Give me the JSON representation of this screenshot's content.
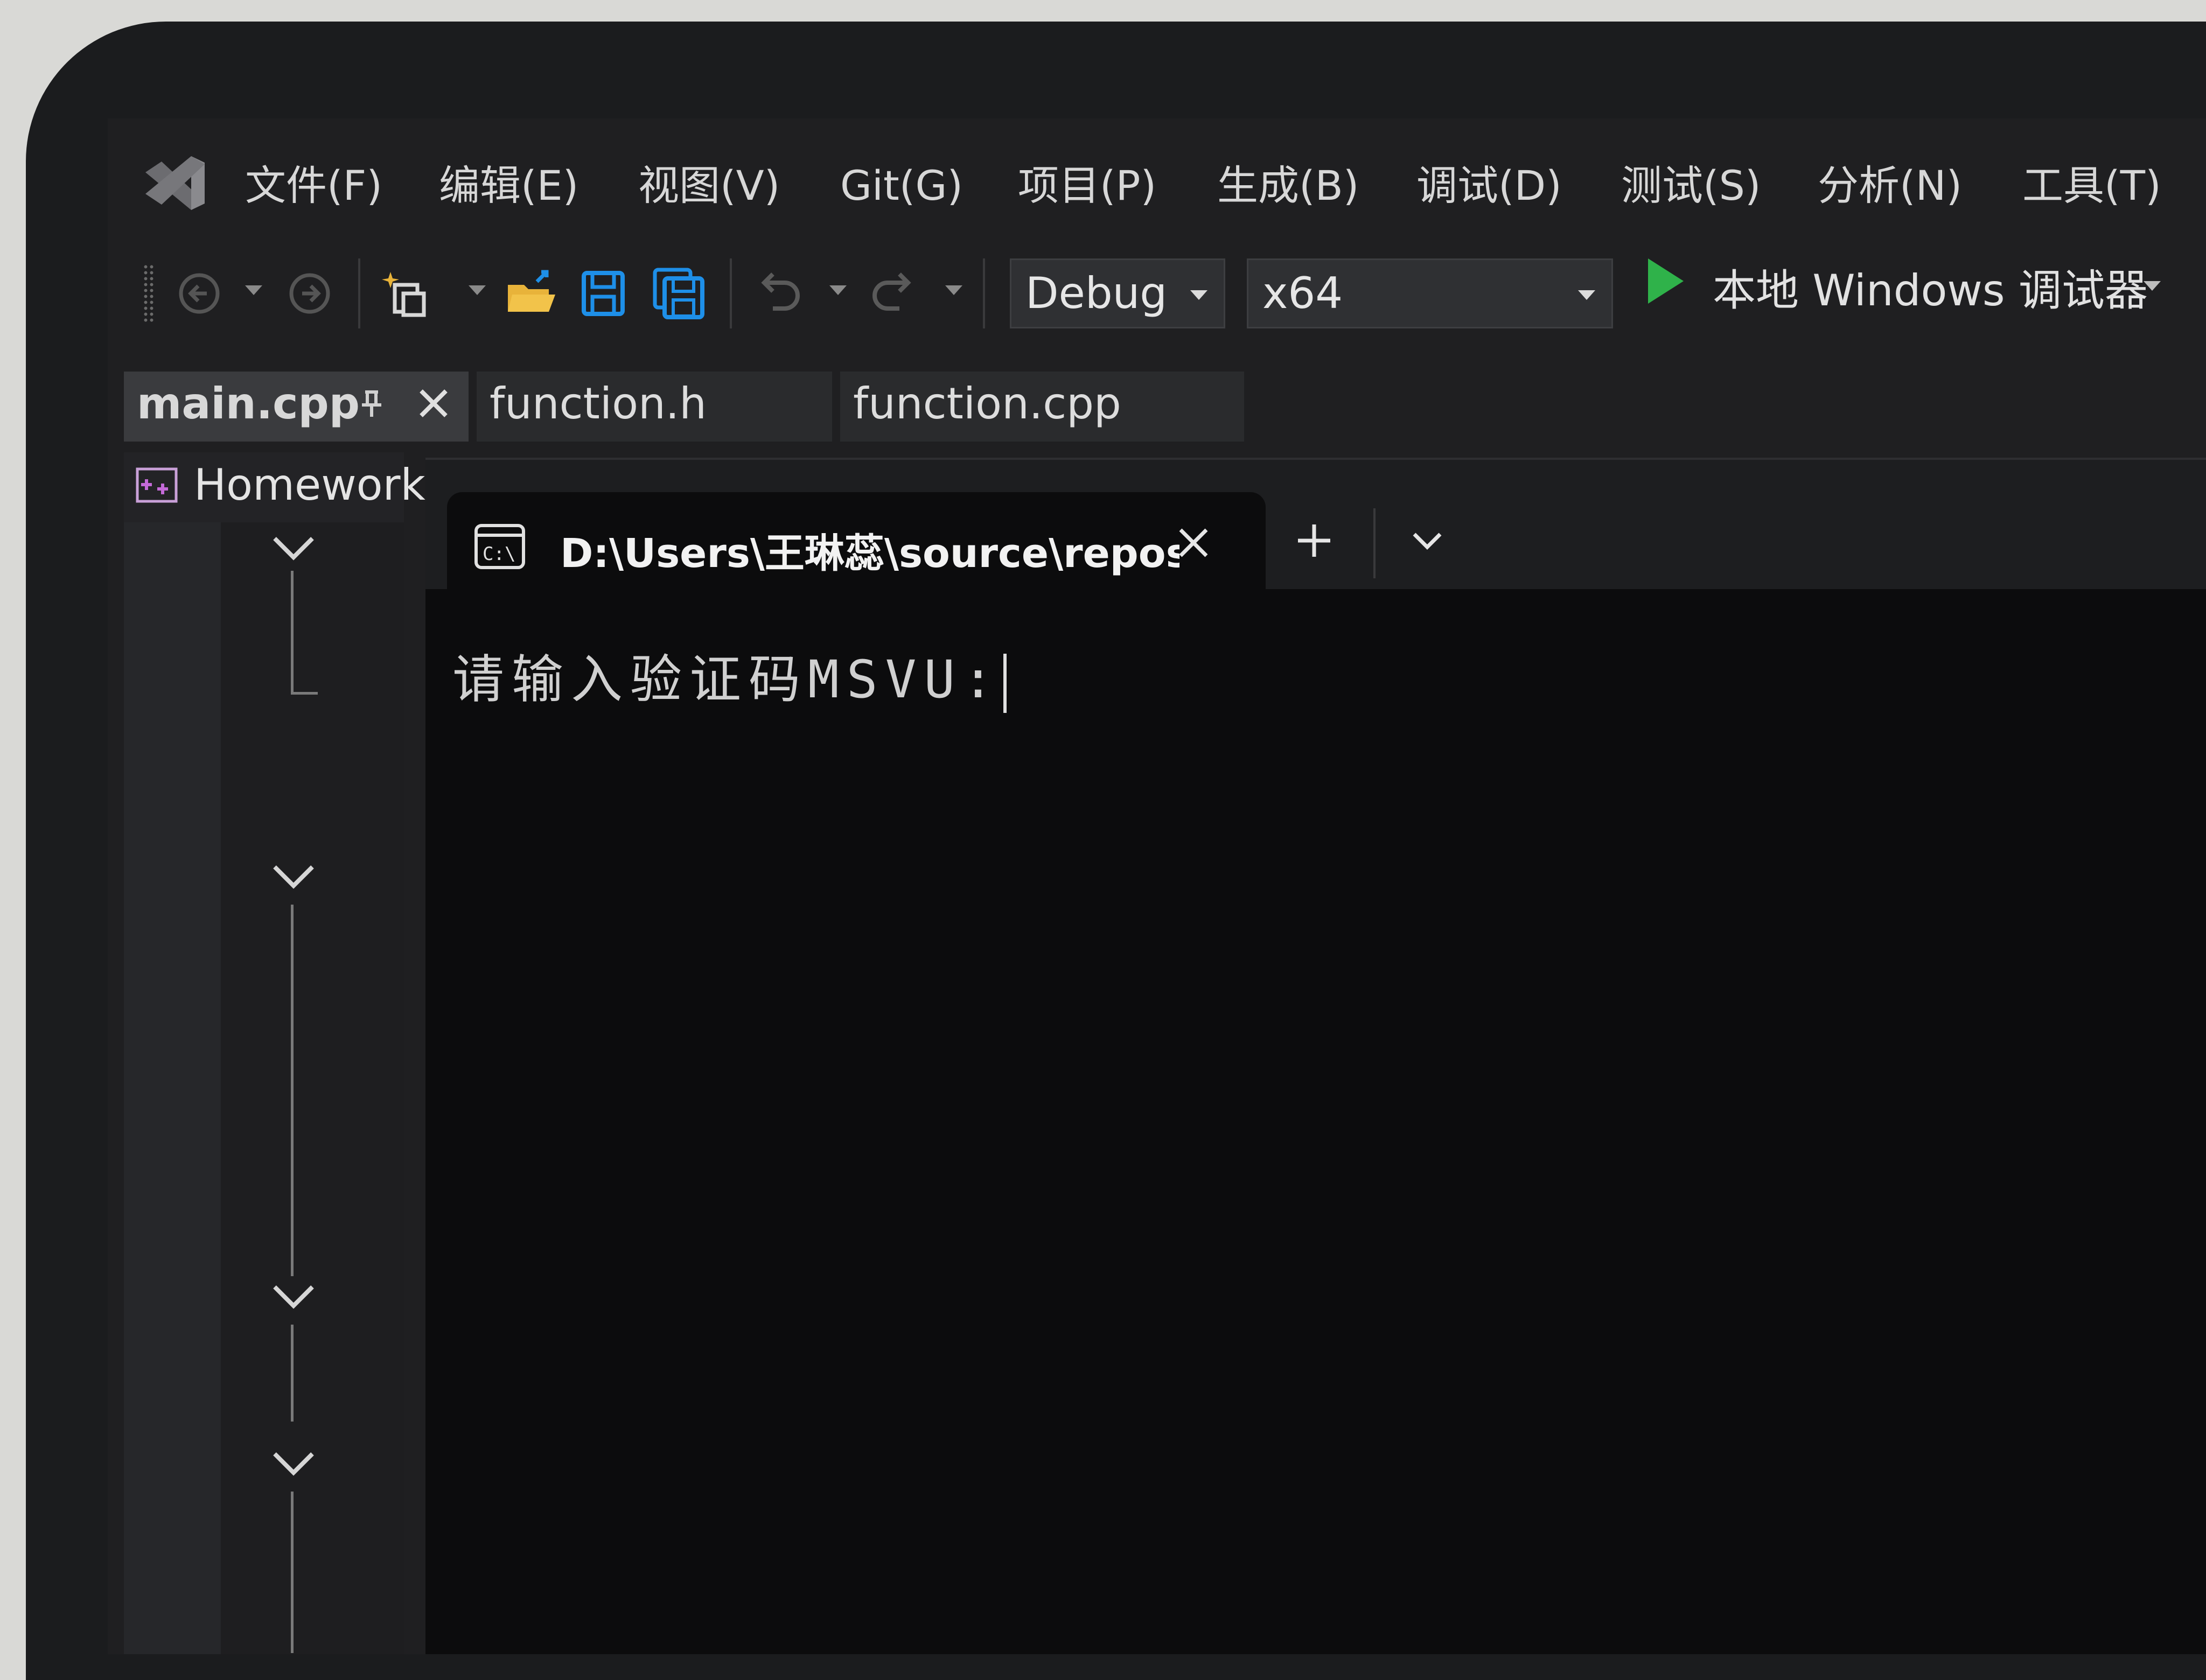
{
  "menu": {
    "items": [
      "文件(F)",
      "编辑(E)",
      "视图(V)",
      "Git(G)",
      "项目(P)",
      "生成(B)",
      "调试(D)",
      "测试(S)",
      "分析(N)",
      "工具(T)"
    ]
  },
  "toolbar": {
    "configuration": "Debug",
    "platform": "x64",
    "start_debugger_label": "本地 Windows 调试器"
  },
  "doc_tabs": [
    {
      "label": "main.cpp",
      "active": true
    },
    {
      "label": "function.h",
      "active": false
    },
    {
      "label": "function.cpp",
      "active": false
    }
  ],
  "solution": {
    "project_name": "Homework"
  },
  "terminal": {
    "tab_title": "D:\\Users\\王琳蕊\\source\\repos",
    "prompt_text": "请输入验证码MSVU:"
  },
  "colors": {
    "accent_green": "#2fb24a",
    "save_blue": "#1e8fe8",
    "folder_yellow": "#e8b33a"
  }
}
